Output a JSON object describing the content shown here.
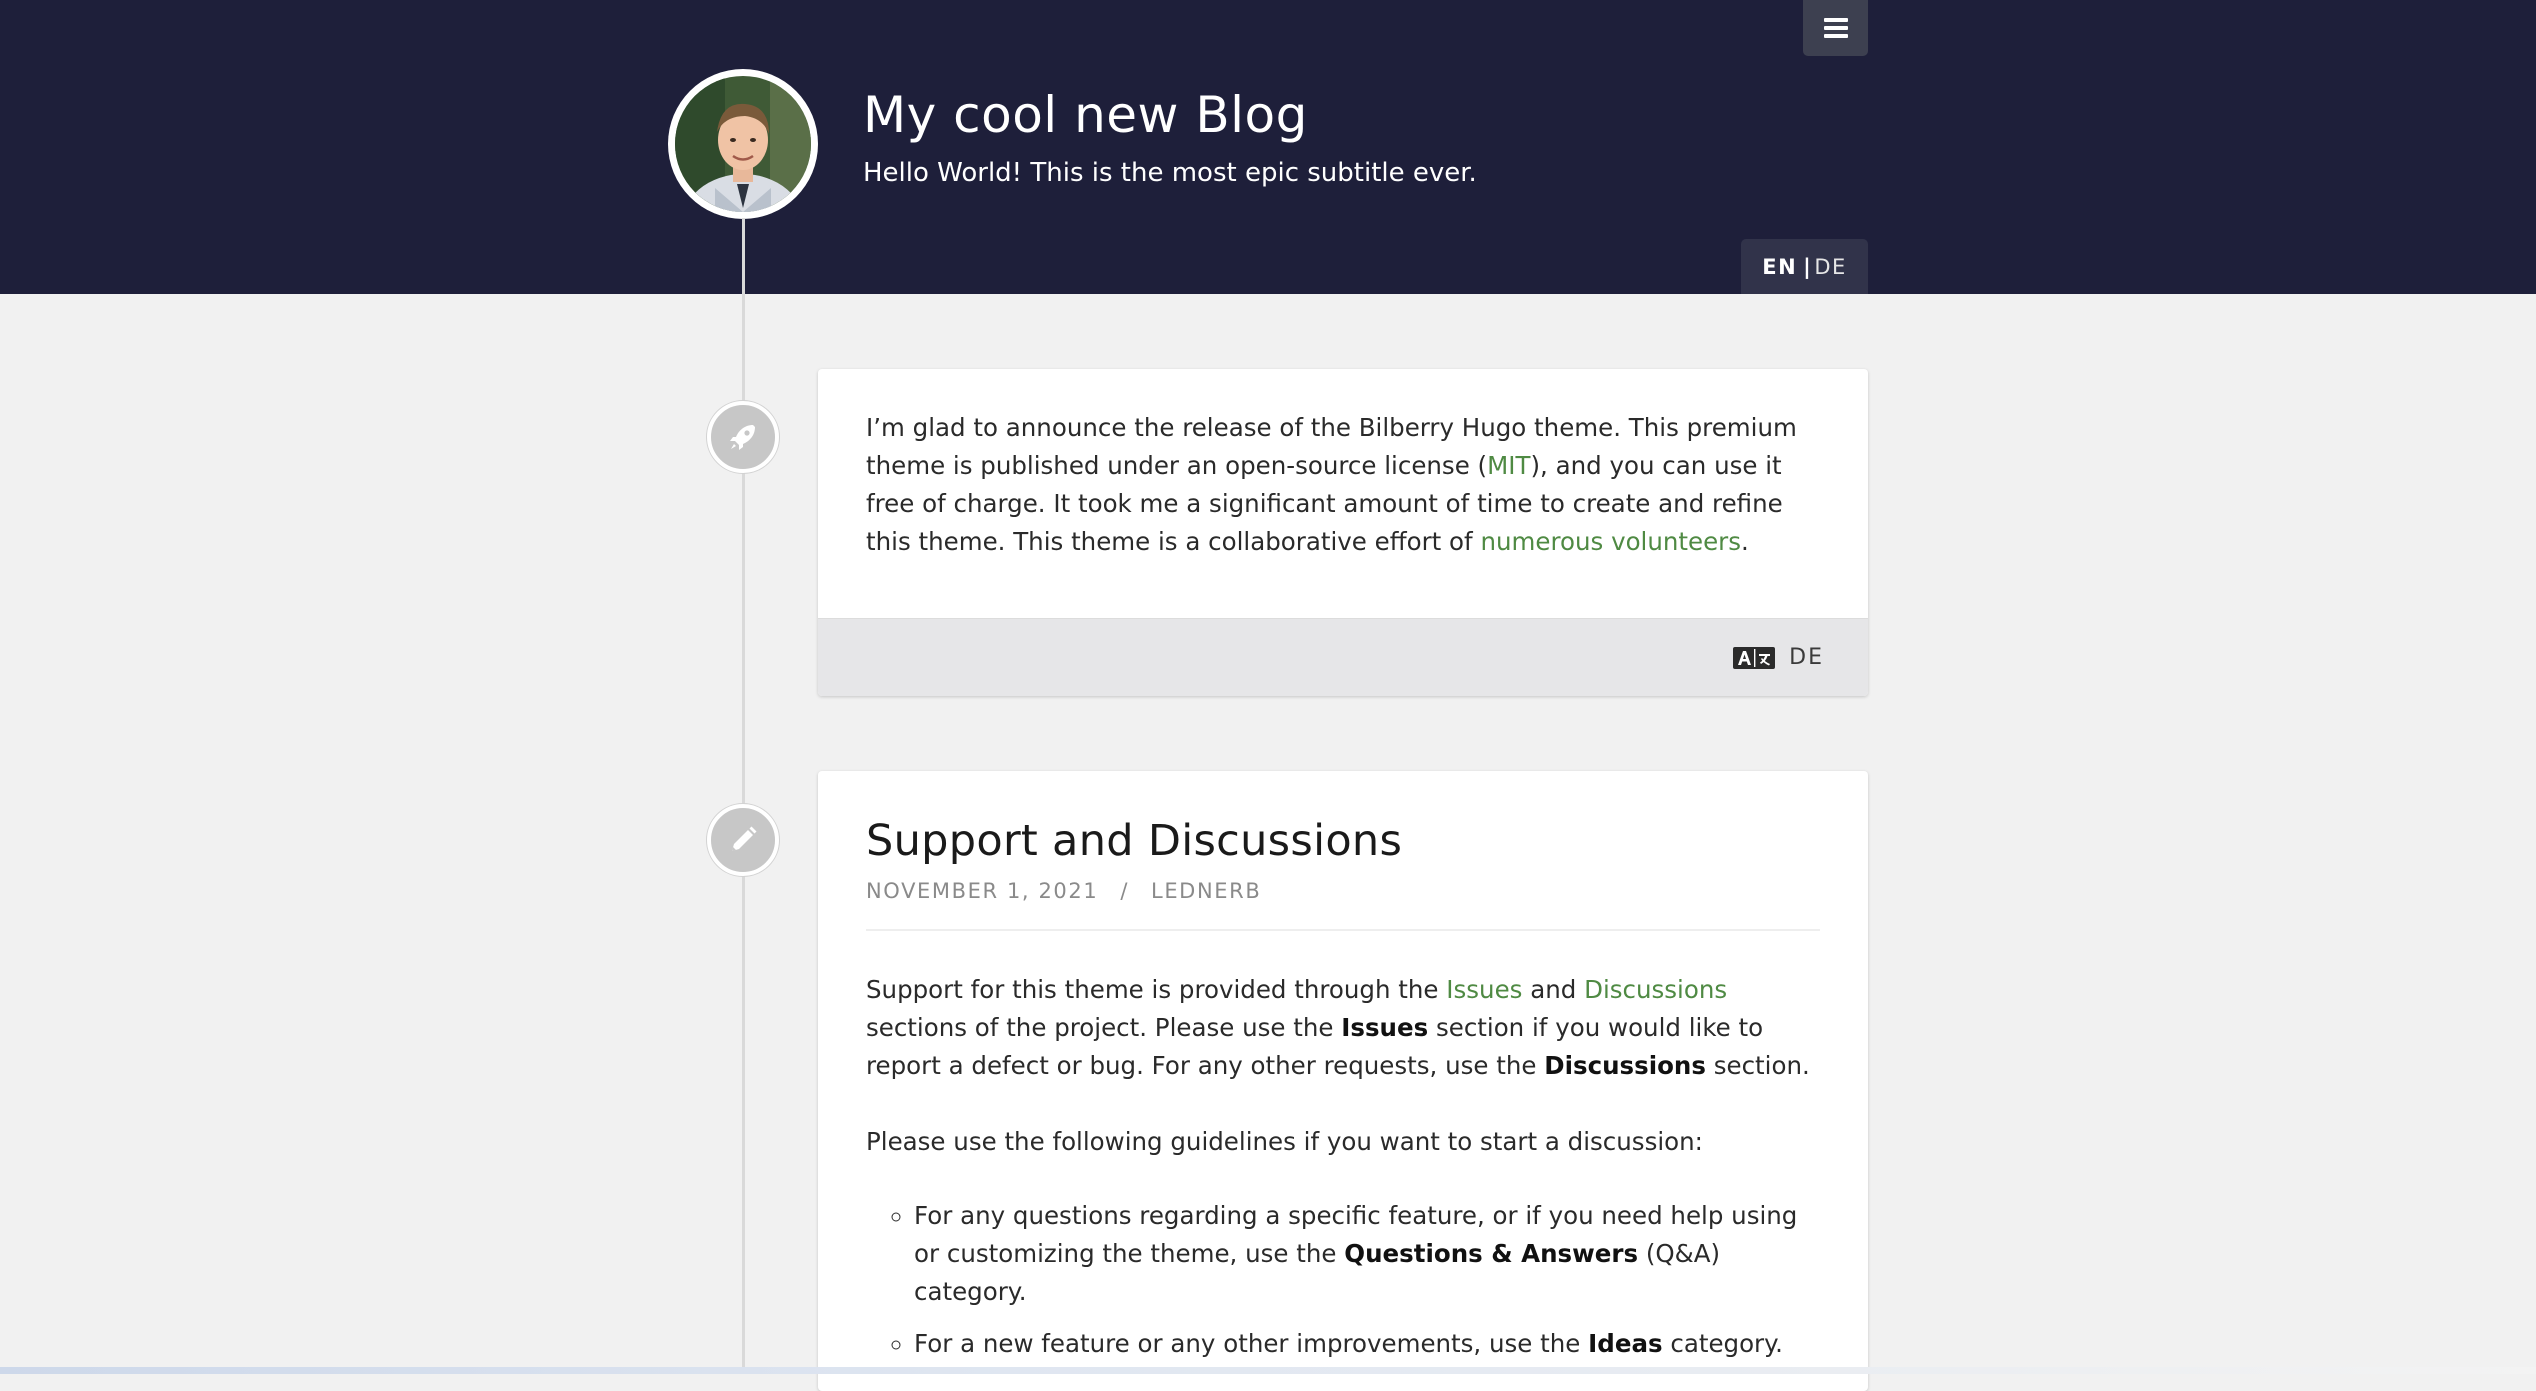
{
  "header": {
    "title": "My cool new Blog",
    "subtitle": "Hello World! This is the most epic subtitle ever.",
    "menu_icon": "hamburger-menu-icon",
    "language": {
      "current": "EN",
      "separator": "|",
      "other": "DE"
    },
    "background_color": "#1e1f3a"
  },
  "posts": [
    {
      "icon": "rocket-icon",
      "text_1": "I’m glad to announce the release of the Bilberry Hugo theme. This premium theme is published under an open-source license (",
      "link_mit": "MIT",
      "text_2": "), and you can use it free of charge. It took me a significant amount of time to create and refine this theme. This theme is a collaborative effort of ",
      "link_volunteers": "numerous volunteers",
      "text_3": ".",
      "footer": {
        "translate_icon": "translate-icon",
        "translation_label": "DE"
      }
    },
    {
      "icon": "pencil-icon",
      "title": "Support and Discussions",
      "date": "NOVEMBER 1, 2021",
      "separator": "/",
      "author": "LEDNERB",
      "p1": {
        "t1": "Support for this theme is provided through the ",
        "link_issues": "Issues",
        "t2": " and ",
        "link_discussions": "Discussions",
        "t3": " sections of the project. Please use the ",
        "b_issues": "Issues",
        "t4": " section if you would like to report a defect or bug. For any other requests, use the ",
        "b_discussions": "Discussions",
        "t5": " section."
      },
      "p2": "Please use the following guidelines if you want to start a discussion:",
      "list": [
        {
          "t1": "For any questions regarding a specific feature, or if you need help using or customizing the theme, use the ",
          "b": "Questions & Answers",
          "t2": " (Q&A) category."
        },
        {
          "t1": "For a new feature or any other improvements, use the ",
          "b": "Ideas",
          "t2": " category."
        }
      ]
    }
  ],
  "colors": {
    "link": "#4f8a43",
    "page_background": "#f1f1f1",
    "card_footer": "#e6e6e8"
  }
}
